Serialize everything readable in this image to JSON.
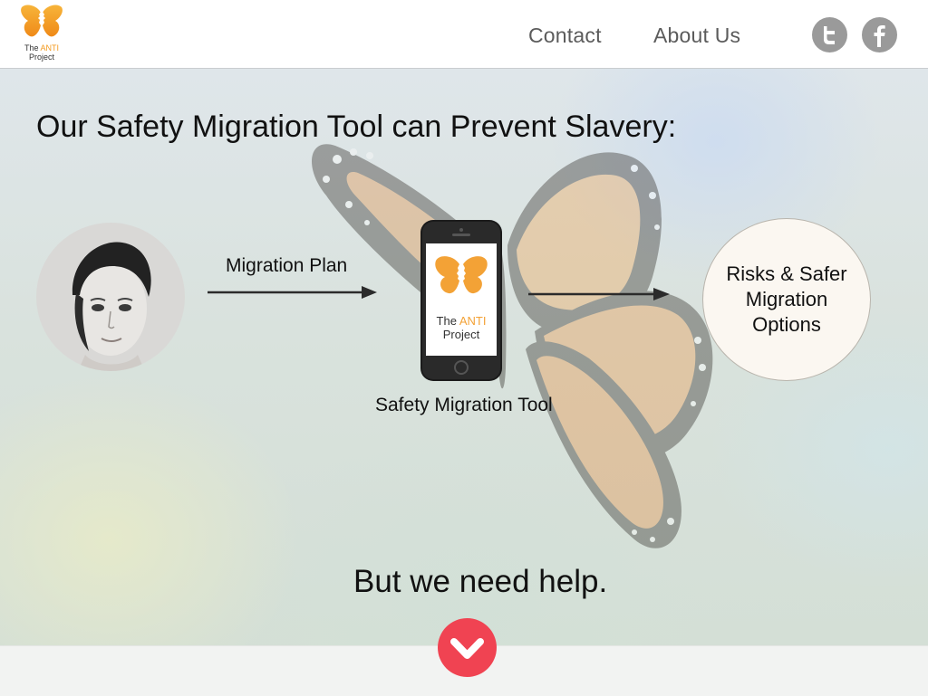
{
  "header": {
    "logo": {
      "line1_prefix": "The ",
      "line1_accent": "ANTI",
      "line2": "Project",
      "icon": "butterfly-faces-icon"
    },
    "nav": {
      "contact": "Contact",
      "about": "About Us"
    },
    "social": {
      "twitter_icon": "twitter-icon",
      "facebook_icon": "facebook-icon"
    }
  },
  "hero": {
    "headline": "Our Safety Migration Tool can Prevent Slavery:",
    "flow": {
      "input_label": "Migration Plan",
      "tool_caption": "Safety Migration Tool",
      "phone_screen_line1_prefix": "The ",
      "phone_screen_line1_accent": "ANTI",
      "phone_screen_line2": "Project",
      "output_label": "Risks & Safer\nMigration\nOptions"
    },
    "cta": "But we need help."
  },
  "colors": {
    "accent_orange": "#f39a1e",
    "cta_red": "#f04352",
    "social_grey": "#9a9a9a",
    "nav_text": "#5b5b5b"
  }
}
